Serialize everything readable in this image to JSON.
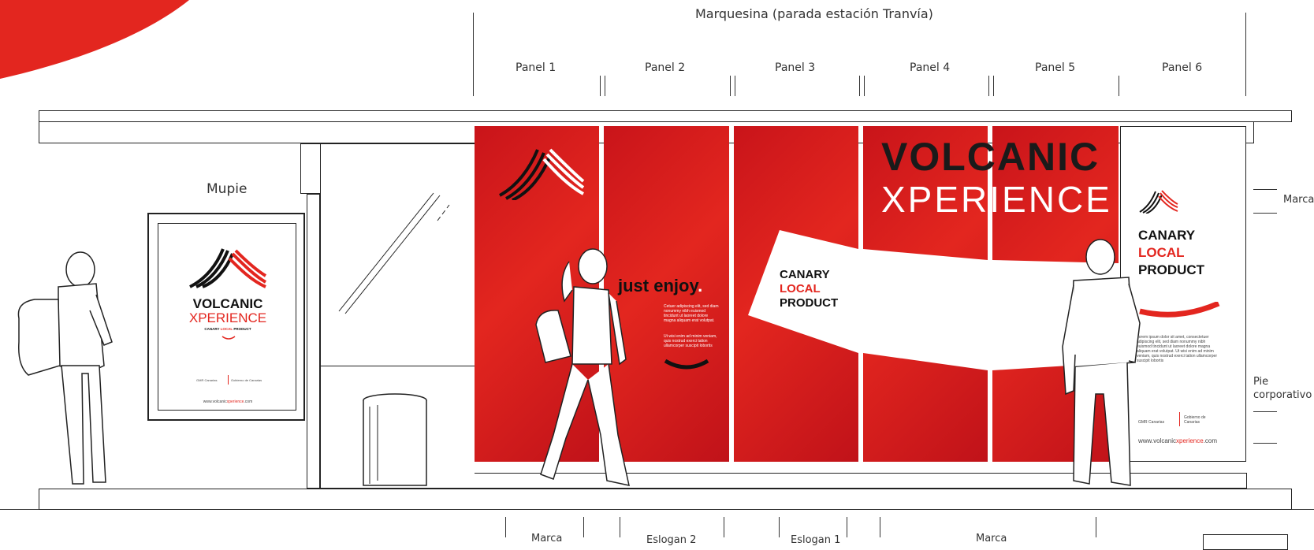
{
  "header": {
    "title": "Marquesina (parada estación Tranvía)",
    "panels": [
      "Panel 1",
      "Panel 2",
      "Panel 3",
      "Panel 4",
      "Panel 5",
      "Panel 6"
    ]
  },
  "mupie": {
    "label": "Mupie",
    "brand_line1": "VOLCANIC",
    "brand_line2": "XPERIENCE",
    "tagline_pre": "CANARY ",
    "tagline_red": "LOCAL",
    "tagline_post": " PRODUCT",
    "logo1": "GMR Canarias",
    "logo2": "Gobierno de Canarias",
    "url_pre": "www.volcanic",
    "url_red": "xperience",
    "url_post": ".com"
  },
  "panel2": {
    "slogan": "just enjoy",
    "slogan_dot": ".",
    "body1": "Cetuer adipiscing elit, sed diam nonummy nibh euismod tincidunt ut laoreet dolore magna aliquam erat volutpat.",
    "body2": "Ut wisi enim ad minim veniam, quis nostrud exerci tation ullamcorper suscipit lobortis"
  },
  "panel3": {
    "line1": "CANARY",
    "line2": "LOCAL",
    "line3": "PRODUCT"
  },
  "panel45": {
    "line1": "VOLCANIC",
    "line2": "XPERIENCE"
  },
  "panel6": {
    "line1": "CANARY",
    "line2": "LOCAL",
    "line3": "PRODUCT",
    "body": "Lorem ipsum dolor sit amet, consectetuer adipiscing elit, sed diam nonummy nibh euismod tincidunt ut laoreet dolore magna aliquam erat volutpat. Ut wisi enim ad minim veniam, quis nostrud exerci tation ullamcorper suscipit lobortis",
    "logo1": "GMR Canarias",
    "logo2": "Gobierno de Canarias",
    "url_pre": "www.volcanic",
    "url_red": "xperience",
    "url_post": ".com"
  },
  "side_labels": {
    "marca": "Marca",
    "pie": "Pie corporativo"
  },
  "bottom_labels": [
    "Marca",
    "Eslogan 2",
    "Eslogan 1",
    "Marca"
  ],
  "colors": {
    "brand_red": "#e3261f",
    "ink": "#222222"
  }
}
